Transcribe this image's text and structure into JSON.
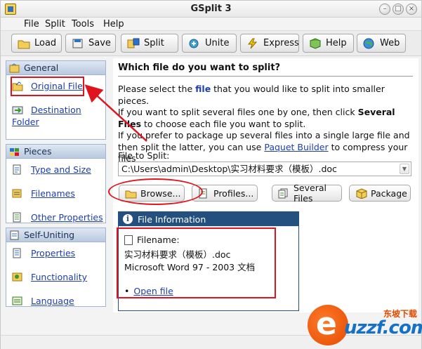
{
  "window": {
    "title": "GSplit 3"
  },
  "menu": [
    "File",
    "Split",
    "Tools",
    "Help"
  ],
  "toolbar": {
    "load": "Load",
    "save": "Save",
    "split": "Split",
    "unite": "Unite",
    "express": "Express",
    "help": "Help",
    "web": "Web"
  },
  "sidebar": {
    "general": {
      "header": "General",
      "original_file": "Original File",
      "destination_folder": "Destination Folder"
    },
    "pieces": {
      "header": "Pieces",
      "type_and_size": "Type and Size",
      "filenames": "Filenames",
      "other_properties": "Other Properties"
    },
    "self_uniting": {
      "header": "Self-Uniting",
      "properties": "Properties",
      "functionality": "Functionality",
      "language": "Language"
    }
  },
  "main": {
    "heading": "Which file do you want to split?",
    "desc": {
      "p1_a": "Please select the ",
      "p1_b": "file",
      "p1_c": " that you would like to split into smaller pieces.",
      "p2_a": "If you want to split several files one by one, then click ",
      "p2_b": "Several Files",
      "p2_c": " to choose each file you want to split.",
      "p3_a": "If you prefer to package up several files into a single large file and then split the latter, you can use ",
      "p3_link": "Paquet Builder",
      "p3_c": " to compress your files"
    },
    "file_to_split_label": "File to Split:",
    "file_to_split_value": "C:\\Users\\admin\\Desktop\\实习材料要求（模板）.doc",
    "buttons": {
      "browse": "Browse...",
      "profiles": "Profiles...",
      "several_files": "Several Files",
      "package": "Package"
    },
    "file_info": {
      "header": "File Information",
      "filename_label": "Filename:",
      "filename_value": "实习材料要求（模板）.doc",
      "type": "Microsoft Word 97 - 2003 文档",
      "bullet": "•",
      "open_file": "Open file"
    }
  },
  "watermark": {
    "domain": "uzzf.com",
    "cn": "东坡下载"
  },
  "colors": {
    "accent": "#24507f",
    "link": "#1e3ea8",
    "highlight": "#e0141e"
  }
}
